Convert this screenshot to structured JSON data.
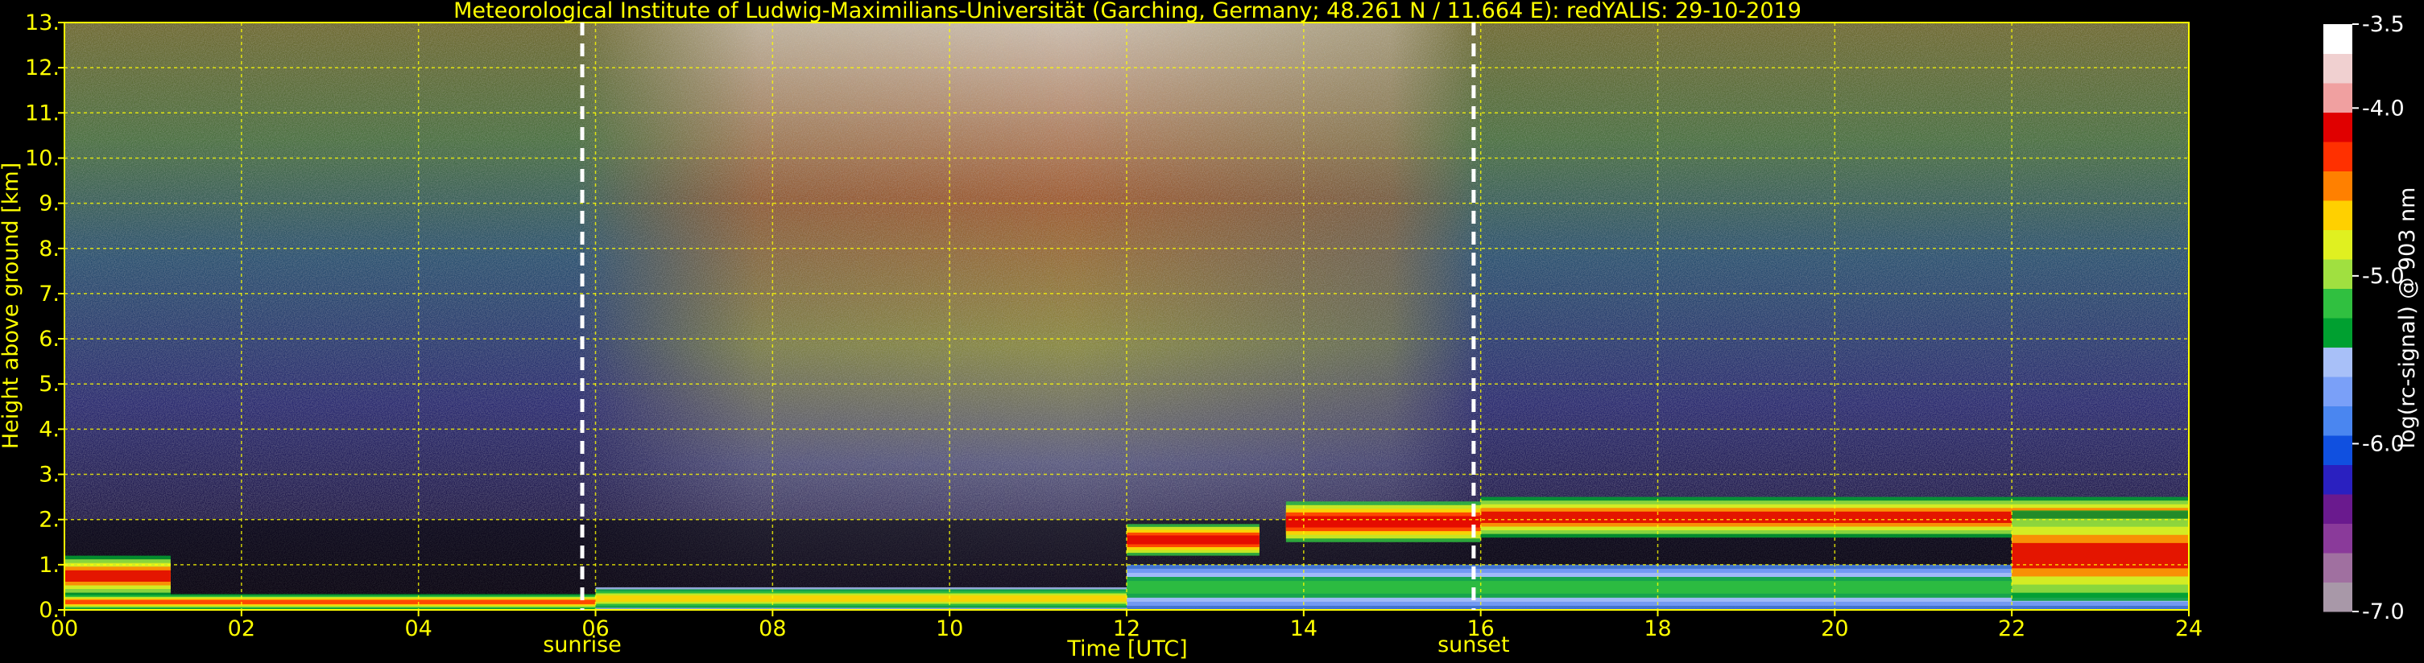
{
  "chart_data": {
    "type": "heatmap",
    "title": "Meteorological Institute of Ludwig-Maximilians-Universität (Garching, Germany; 48.261 N / 11.664 E):    redYALIS: 29-10-2019",
    "xlabel": "Time [UTC]",
    "ylabel": "Height above ground [km]",
    "xlim": [
      0,
      24
    ],
    "ylim": [
      0,
      13
    ],
    "x_ticks": [
      0,
      2,
      4,
      6,
      8,
      10,
      12,
      14,
      16,
      18,
      20,
      22,
      24
    ],
    "x_tick_labels": [
      "00",
      "02",
      "04",
      "06",
      "08",
      "10",
      "12",
      "14",
      "16",
      "18",
      "20",
      "22",
      "24"
    ],
    "y_ticks": [
      0,
      1,
      2,
      3,
      4,
      5,
      6,
      7,
      8,
      9,
      10,
      11,
      12,
      13
    ],
    "y_tick_labels": [
      "0.",
      "1.",
      "2.",
      "3.",
      "4.",
      "5.",
      "6.",
      "7.",
      "8.",
      "9.",
      "10.",
      "11.",
      "12.",
      "13."
    ],
    "grid": true,
    "annotations": [
      {
        "x": 5.85,
        "label": "sunrise"
      },
      {
        "x": 15.92,
        "label": "sunset"
      }
    ],
    "colorbar": {
      "label": "log(rc-signal) @ 903 nm",
      "range": [
        -7.0,
        -3.5
      ],
      "ticks": [
        -3.5,
        -4.0,
        -5.0,
        -6.0,
        -7.0
      ],
      "tick_labels": [
        "-3.5",
        "-4.0",
        "-5.0",
        "-6.0",
        "-7.0"
      ],
      "colors": [
        "#a898a8",
        "#a070a0",
        "#8a3a9a",
        "#6a1a8e",
        "#2a20c0",
        "#1050e0",
        "#4a86f0",
        "#7aa0f8",
        "#a8c0f8",
        "#00a030",
        "#30c040",
        "#a0e040",
        "#e0f020",
        "#ffd000",
        "#ff8000",
        "#ff3000",
        "#e00000",
        "#f0a0a0",
        "#f0d0d0",
        "#ffffff"
      ]
    },
    "cloud_layers": [
      {
        "t0": 0.0,
        "t1": 1.2,
        "h0": 0.3,
        "h1": 1.2,
        "intensity": 0.9
      },
      {
        "t0": 0.0,
        "t1": 6.0,
        "h0": 0.0,
        "h1": 0.35,
        "intensity": 0.85
      },
      {
        "t0": 6.0,
        "t1": 12.0,
        "h0": 0.0,
        "h1": 0.5,
        "intensity": 0.75
      },
      {
        "t0": 12.0,
        "t1": 13.5,
        "h0": 1.2,
        "h1": 1.9,
        "intensity": 0.95
      },
      {
        "t0": 13.8,
        "t1": 16.0,
        "h0": 1.5,
        "h1": 2.4,
        "intensity": 0.95
      },
      {
        "t0": 16.0,
        "t1": 24.0,
        "h0": 1.6,
        "h1": 2.5,
        "intensity": 0.9
      },
      {
        "t0": 12.0,
        "t1": 24.0,
        "h0": 0.0,
        "h1": 1.0,
        "intensity": 0.6
      },
      {
        "t0": 22.0,
        "t1": 24.0,
        "h0": 0.2,
        "h1": 2.2,
        "intensity": 0.9
      }
    ]
  }
}
